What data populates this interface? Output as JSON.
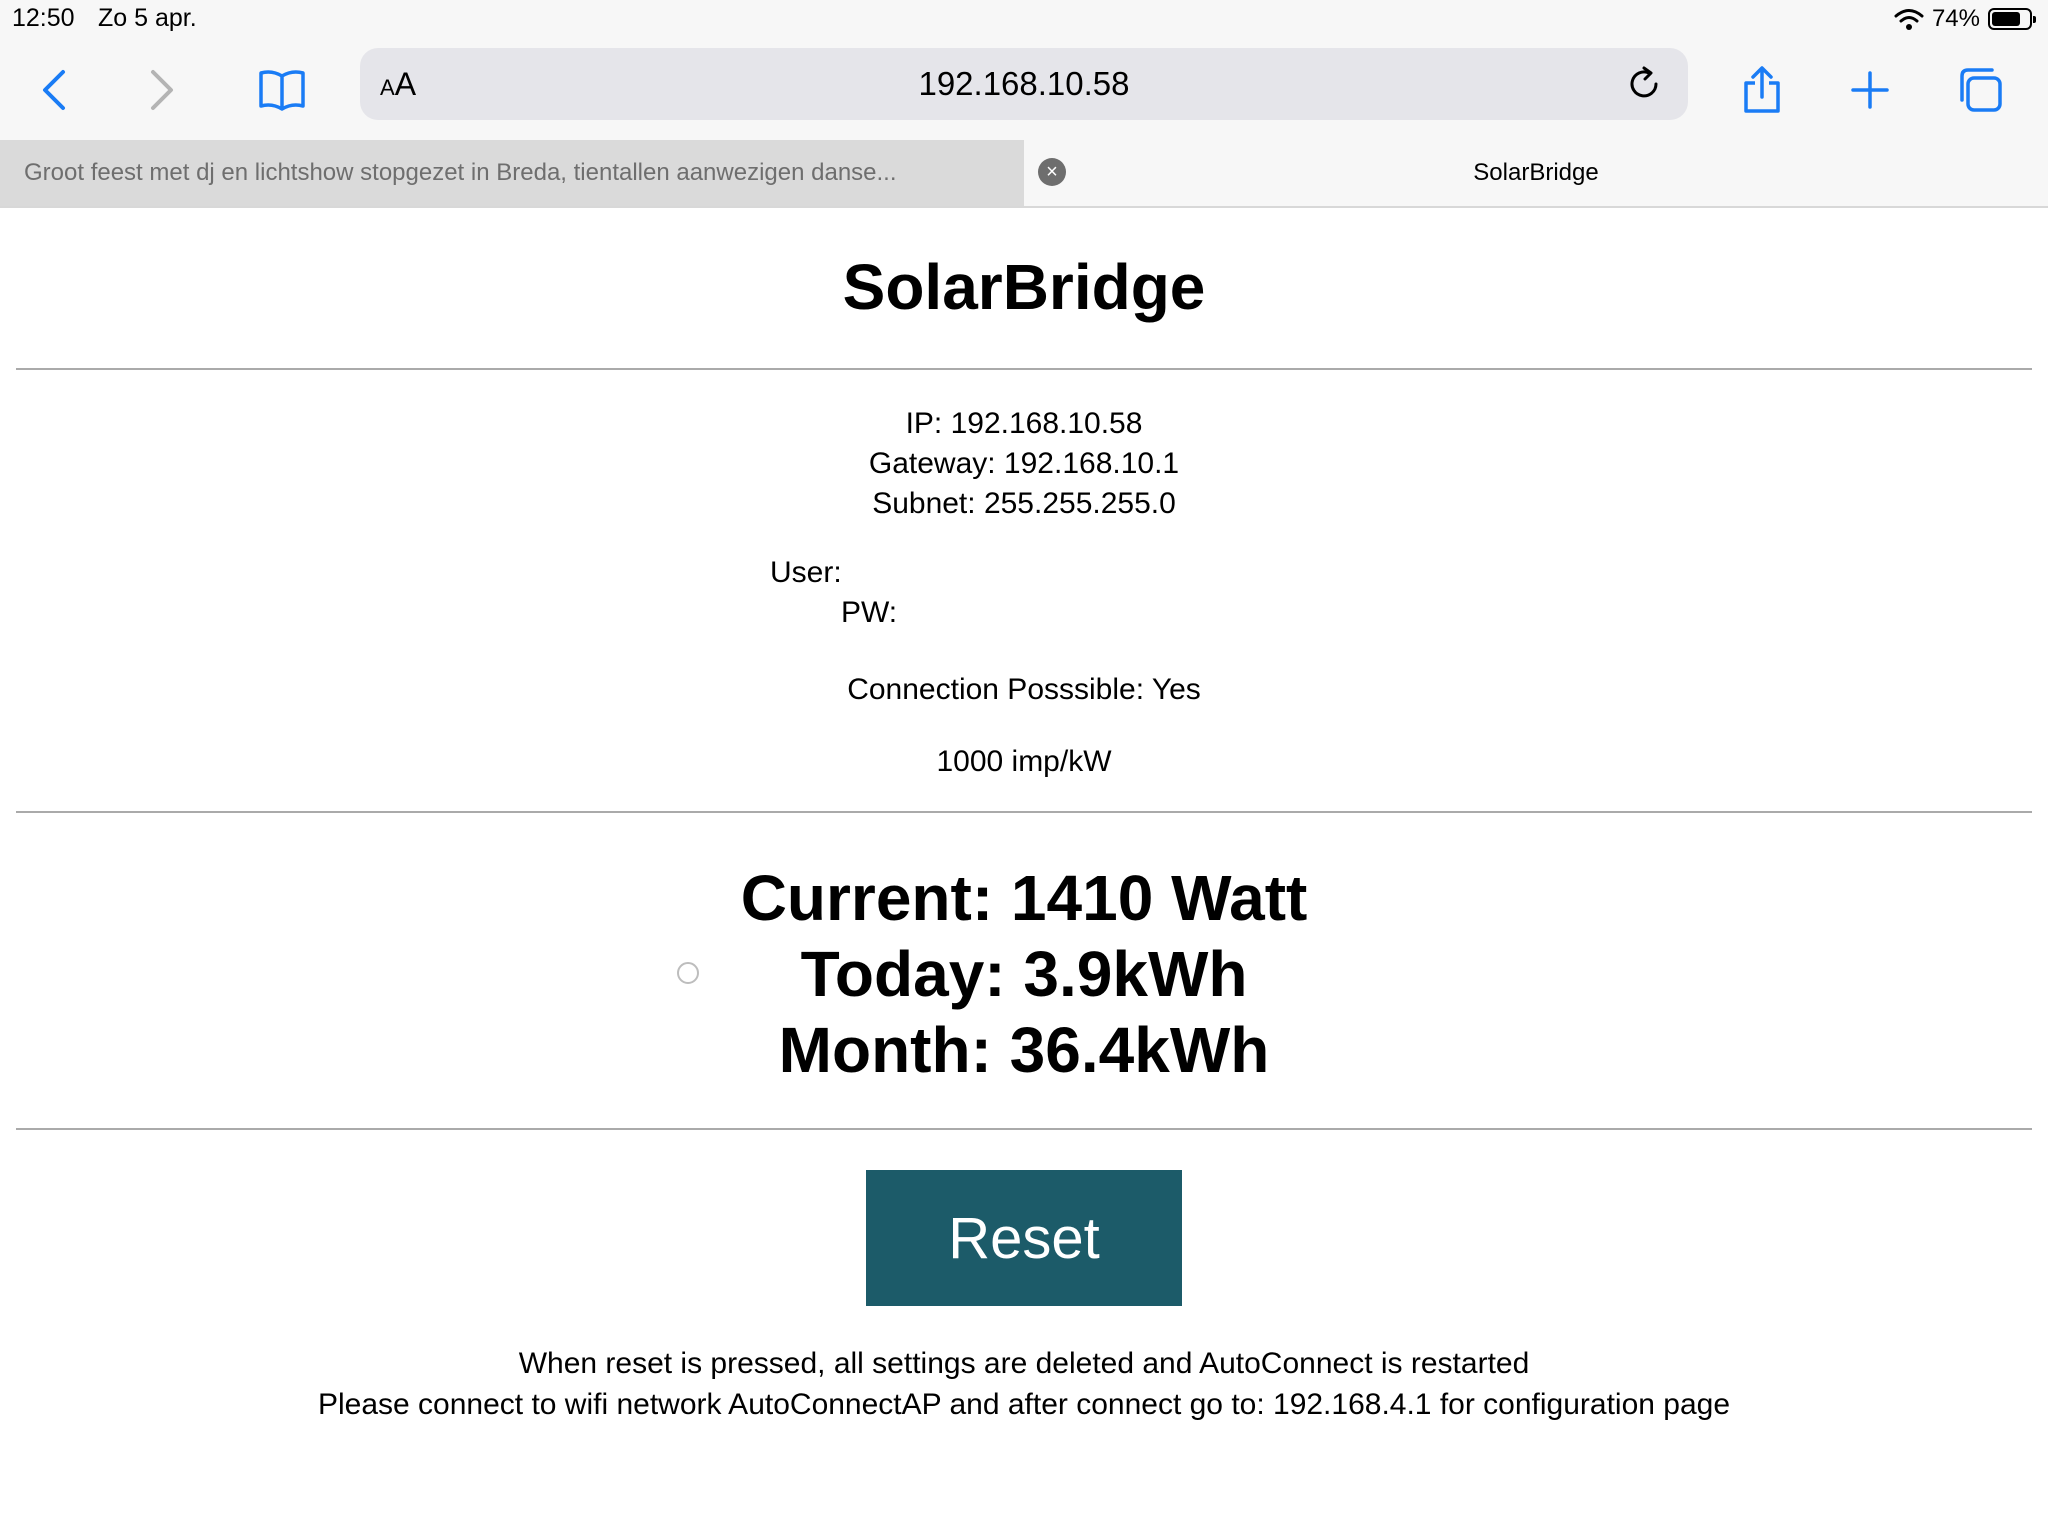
{
  "status_bar": {
    "time": "12:50",
    "date": "Zo 5 apr.",
    "battery": "74%"
  },
  "toolbar": {
    "icons": [
      "chevron-left-icon",
      "chevron-right-icon",
      "bookmarks-icon",
      "reload-icon",
      "share-icon",
      "plus-icon",
      "tabs-icon"
    ],
    "address": {
      "aa_small": "A",
      "aa_large": "A",
      "url": "192.168.10.58"
    }
  },
  "tabs": [
    {
      "label": "Groot feest met dj en lichtshow stopgezet in Breda, tientallen aanwezigen danse...",
      "active": false
    },
    {
      "label": "SolarBridge",
      "active": true
    }
  ],
  "page": {
    "title": "SolarBridge",
    "ip": "IP: 192.168.10.58",
    "gateway": "Gateway: 192.168.10.1",
    "subnet": "Subnet: 255.255.255.0",
    "user_label": "User:",
    "pw_label": "PW:",
    "connection": "Connection Posssible: Yes",
    "imp": "1000 imp/kW",
    "current": "Current: 1410 Watt",
    "today": "Today: 3.9kWh",
    "month": "Month: 36.4kWh",
    "reset_label": "Reset",
    "note_line1": "When reset is pressed, all settings are deleted and AutoConnect is restarted",
    "note_line2": "Please connect to wifi network AutoConnectAP and after connect go to: 192.168.4.1 for configuration page"
  },
  "colors": {
    "accent_blue": "#1a7cf5",
    "reset_button": "#1c5b69"
  }
}
